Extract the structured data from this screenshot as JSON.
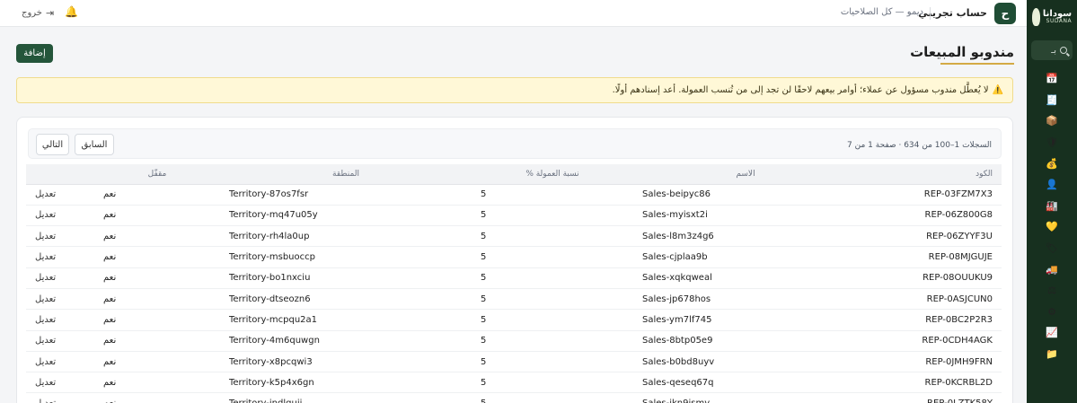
{
  "brand": {
    "name": "سودانا",
    "sub": "SUDANA"
  },
  "sidebar": {
    "search_label": "بـ",
    "items": [
      {
        "icon": "calendar-icon",
        "glyph": "📅"
      },
      {
        "icon": "cash-register-icon",
        "glyph": "🧾"
      },
      {
        "icon": "box-icon",
        "glyph": "📦"
      },
      {
        "icon": "shield-icon",
        "glyph": "🛡"
      },
      {
        "icon": "money-bag-icon",
        "glyph": "💰"
      },
      {
        "icon": "person-icon",
        "glyph": "👤"
      },
      {
        "icon": "factory-icon",
        "glyph": "🏭"
      },
      {
        "icon": "heart-icon",
        "glyph": "💛"
      },
      {
        "icon": "tag-icon",
        "glyph": "🏷"
      },
      {
        "icon": "truck-icon",
        "glyph": "🚚"
      },
      {
        "icon": "scales-icon",
        "glyph": "⚖"
      },
      {
        "icon": "gear-icon",
        "glyph": "⚙"
      },
      {
        "icon": "chart-icon",
        "glyph": "📈"
      },
      {
        "icon": "folder-icon",
        "glyph": "📁"
      }
    ]
  },
  "topbar": {
    "avatar_letter": "ح",
    "account_name": "حساب تجريبي",
    "role_text": "ديمو — كل الصلاحيات",
    "logout_label": "خروج",
    "logout_icon": "⇥",
    "bell_icon": "🔔"
  },
  "page": {
    "title": "مندوبو المبيعات",
    "add_label": "إضافة",
    "alert_icon": "⚠️",
    "alert_text": "لا يُعطَّل مندوب مسؤول عن عملاء؛ أوامر بيعهم لاحقًا لن تجد إلى من تُنسب العمولة. أعد إسنادهم أولًا."
  },
  "pager": {
    "info": "السجلات 1–100 من 634 · صفحة 1 من 7",
    "prev_label": "السابق",
    "next_label": "التالي"
  },
  "table": {
    "headers": {
      "code": "الكود",
      "name": "الاسم",
      "pct": "نسبة العمولة %",
      "territory": "المنطقة",
      "locked": "مقفّل"
    },
    "rows": [
      {
        "code": "REP-03FZM7X3",
        "name": "Sales-beipyc86",
        "pct": "5",
        "territory": "Territory-87os7fsr",
        "locked": "نعم",
        "action": "تعديل"
      },
      {
        "code": "REP-06Z800G8",
        "name": "Sales-myisxt2i",
        "pct": "5",
        "territory": "Territory-mq47u05y",
        "locked": "نعم",
        "action": "تعديل"
      },
      {
        "code": "REP-06ZYYF3U",
        "name": "Sales-l8m3z4g6",
        "pct": "5",
        "territory": "Territory-rh4la0up",
        "locked": "نعم",
        "action": "تعديل"
      },
      {
        "code": "REP-08MJGUJE",
        "name": "Sales-cjplaa9b",
        "pct": "5",
        "territory": "Territory-msbuoccp",
        "locked": "نعم",
        "action": "تعديل"
      },
      {
        "code": "REP-08OUUKU9",
        "name": "Sales-xqkqweal",
        "pct": "5",
        "territory": "Territory-bo1nxciu",
        "locked": "نعم",
        "action": "تعديل"
      },
      {
        "code": "REP-0ASJCUN0",
        "name": "Sales-jp678hos",
        "pct": "5",
        "territory": "Territory-dtseozn6",
        "locked": "نعم",
        "action": "تعديل"
      },
      {
        "code": "REP-0BC2P2R3",
        "name": "Sales-ym7lf745",
        "pct": "5",
        "territory": "Territory-mcpqu2a1",
        "locked": "نعم",
        "action": "تعديل"
      },
      {
        "code": "REP-0CDH4AGK",
        "name": "Sales-8btp05e9",
        "pct": "5",
        "territory": "Territory-4m6quwgn",
        "locked": "نعم",
        "action": "تعديل"
      },
      {
        "code": "REP-0JMH9FRN",
        "name": "Sales-b0bd8uyv",
        "pct": "5",
        "territory": "Territory-x8pcqwi3",
        "locked": "نعم",
        "action": "تعديل"
      },
      {
        "code": "REP-0KCRBL2D",
        "name": "Sales-qeseq67q",
        "pct": "5",
        "territory": "Territory-k5p4x6gn",
        "locked": "نعم",
        "action": "تعديل"
      },
      {
        "code": "REP-0LZTK58Y",
        "name": "Sales-ikn9jsmv",
        "pct": "5",
        "territory": "Territory-jndlguij",
        "locked": "نعم",
        "action": "تعديل"
      }
    ]
  }
}
